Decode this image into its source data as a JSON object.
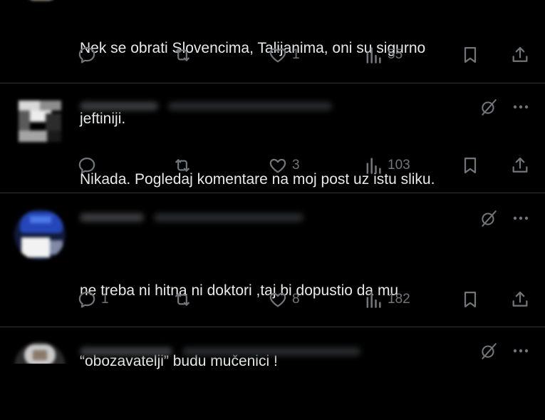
{
  "posts": [
    {
      "text_line1": "Nek se obrati Slovencima, Talijanima, oni su sigurno",
      "text_line2": "jeftiniji.",
      "reply_count": "",
      "like_count": "1",
      "view_count": "55"
    },
    {
      "text_line1": "Nikada. Pogledaj komentare na moj post uz istu sliku.",
      "text_line2": "",
      "reply_count": "",
      "like_count": "3",
      "view_count": "103"
    },
    {
      "text_line1": "ne treba ni hitna ni doktori ,taj bi dopustio da mu",
      "text_line2": "“obozavatelji” budu mučenici !",
      "reply_count": "1",
      "like_count": "8",
      "view_count": "182"
    },
    {
      "text_line1": "",
      "text_line2": "",
      "reply_count": "",
      "like_count": "",
      "view_count": ""
    }
  ],
  "colors": {
    "background": "#000000",
    "text": "#e7e9ea",
    "icon": "#71767b",
    "divider": "#2f3336"
  },
  "icons": [
    "reply-icon",
    "repost-icon",
    "like-icon",
    "views-icon",
    "bookmark-icon",
    "share-icon",
    "grok-icon",
    "more-icon"
  ]
}
